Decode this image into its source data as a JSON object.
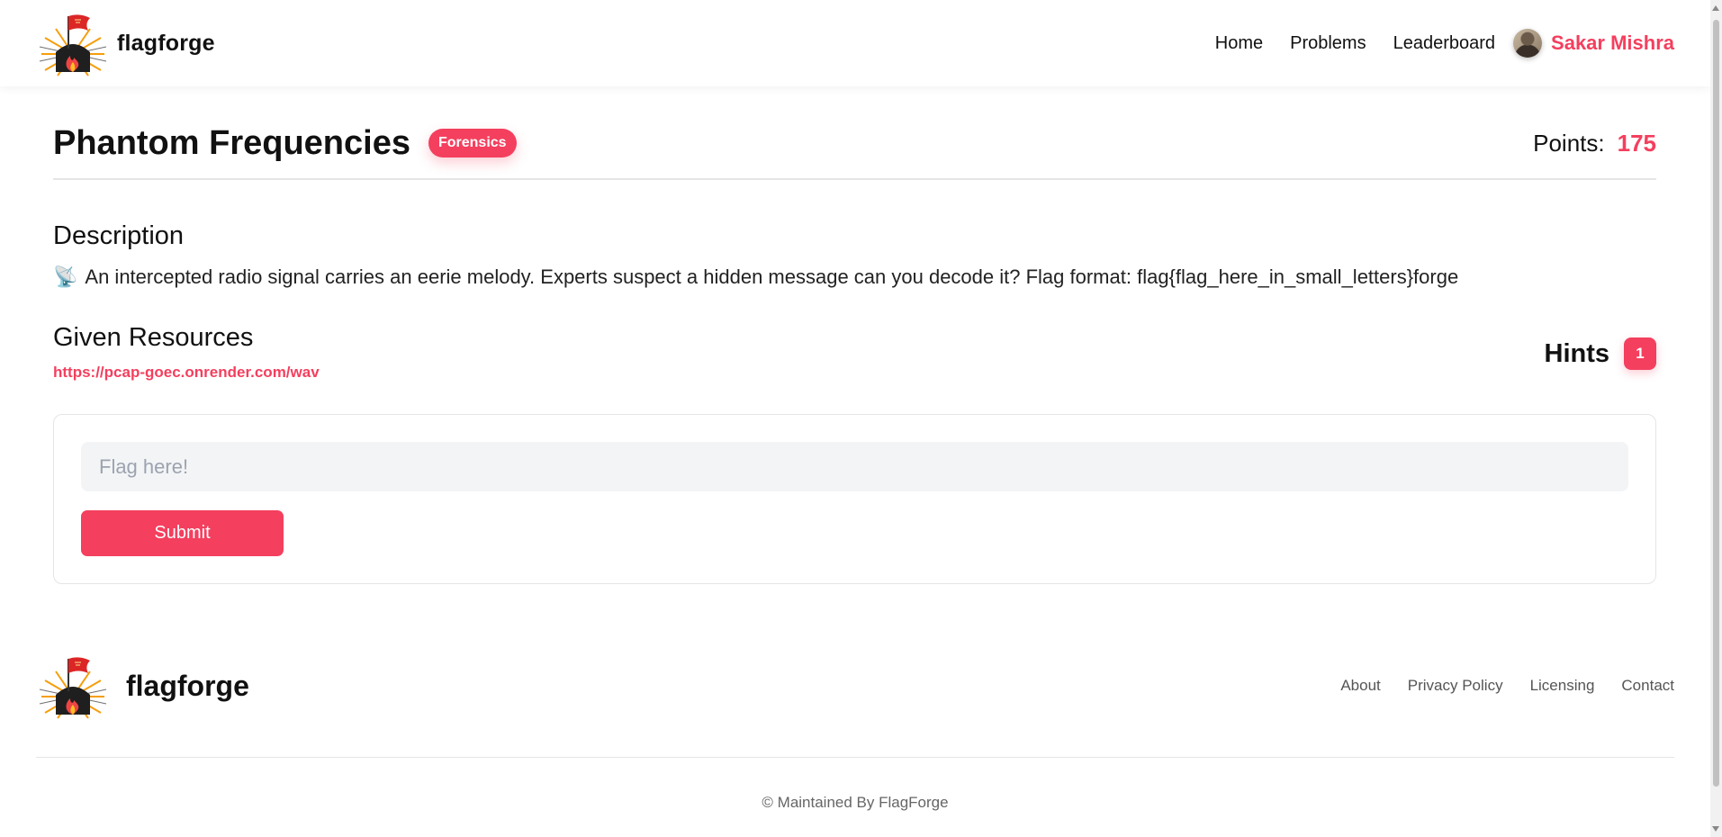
{
  "nav": {
    "brand": "flagforge",
    "links": [
      "Home",
      "Problems",
      "Leaderboard"
    ],
    "user_name": "Sakar Mishra"
  },
  "problem": {
    "title": "Phantom Frequencies",
    "category": "Forensics",
    "points_label": "Points:",
    "points": "175",
    "description_heading": "Description",
    "description": "An intercepted radio signal carries an eerie melody. Experts suspect a hidden message can you decode it? Flag format: flag{flag_here_in_small_letters}forge",
    "resources_heading": "Given Resources",
    "resource_link": "https://pcap-goec.onrender.com/wav",
    "hints_label": "Hints",
    "hints_count": "1"
  },
  "flag_form": {
    "placeholder": "Flag here!",
    "submit_label": "Submit"
  },
  "footer": {
    "brand": "flagforge",
    "links": [
      "About",
      "Privacy Policy",
      "Licensing",
      "Contact"
    ],
    "copyright": "© Maintained By FlagForge"
  },
  "colors": {
    "accent": "#f43f5e",
    "input_bg": "#f3f4f6"
  },
  "icons": {
    "logo": "flag-fire-logo-icon",
    "description": "satellite-antenna-icon"
  }
}
